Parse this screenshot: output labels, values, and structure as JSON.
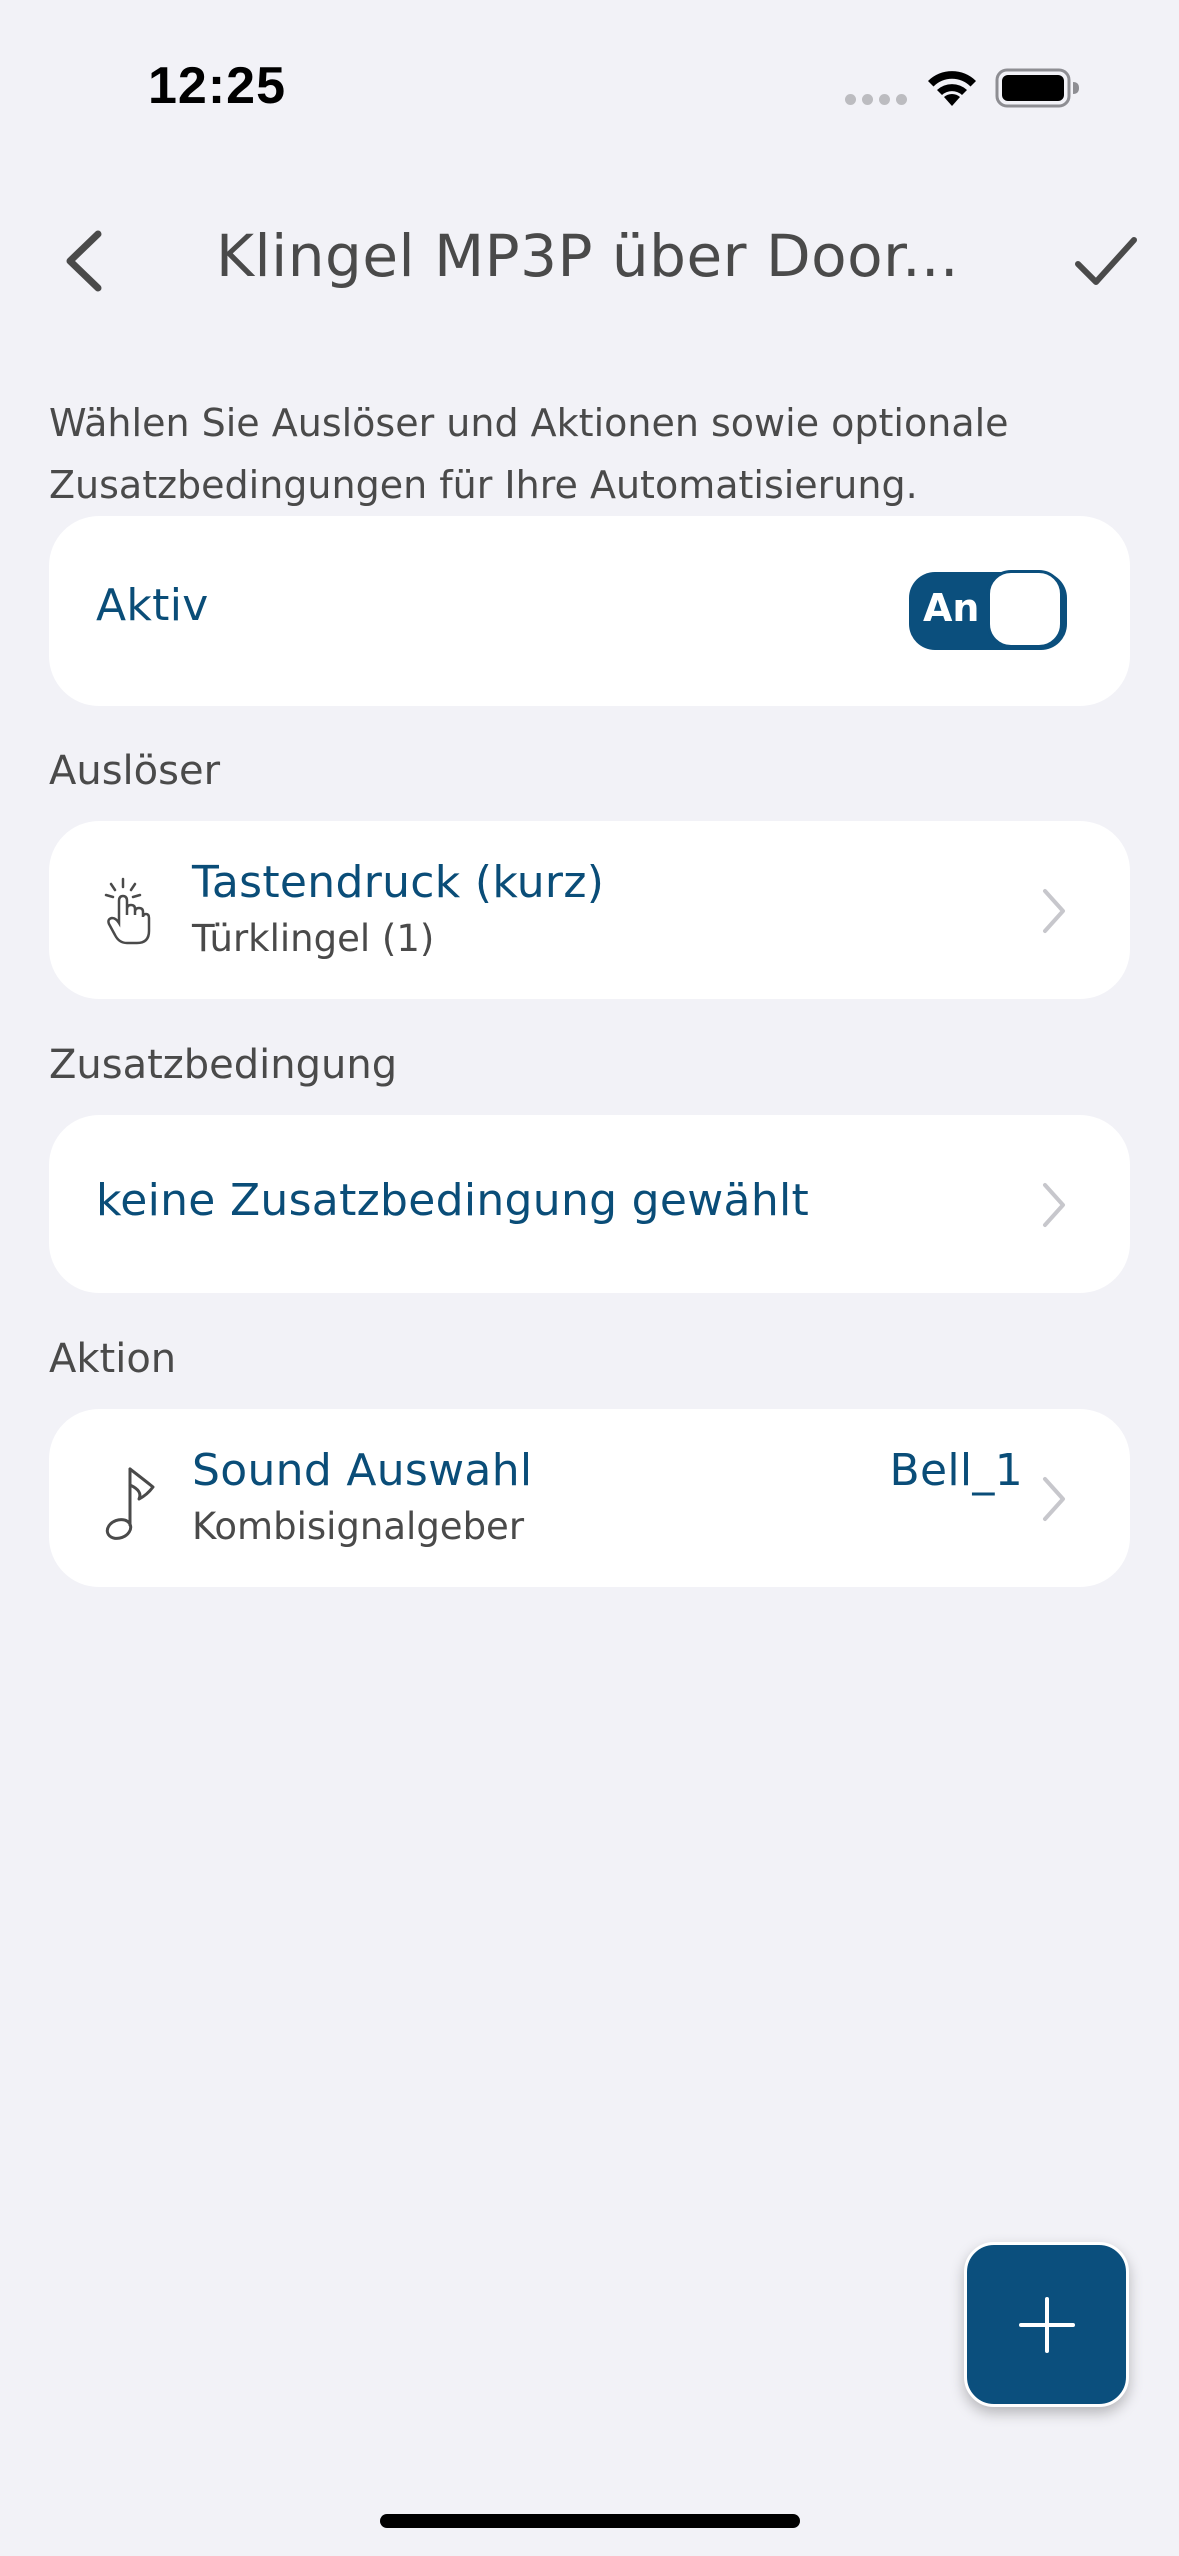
{
  "status_bar": {
    "time": "12:25"
  },
  "nav": {
    "title": "Klingel MP3P über Door..."
  },
  "description": "Wählen Sie Auslöser und Aktionen sowie optionale Zusatzbedingungen für Ihre Automatisierung.",
  "active": {
    "label": "Aktiv",
    "toggle_label": "An",
    "on": true
  },
  "trigger": {
    "header": "Auslöser",
    "title": "Tastendruck (kurz)",
    "subtitle": "Türklingel (1)",
    "icon": "hand-tap-icon"
  },
  "condition": {
    "header": "Zusatzbedingung",
    "text": "keine Zusatzbedingung gewählt"
  },
  "action": {
    "header": "Aktion",
    "title": "Sound Auswahl",
    "subtitle": "Kombisignalgeber",
    "value": "Bell_1",
    "icon": "music-note-icon"
  },
  "colors": {
    "accent": "#0b4f7d",
    "background": "#f2f2f7",
    "card": "#ffffff",
    "secondary_text": "#4a4a4a"
  }
}
